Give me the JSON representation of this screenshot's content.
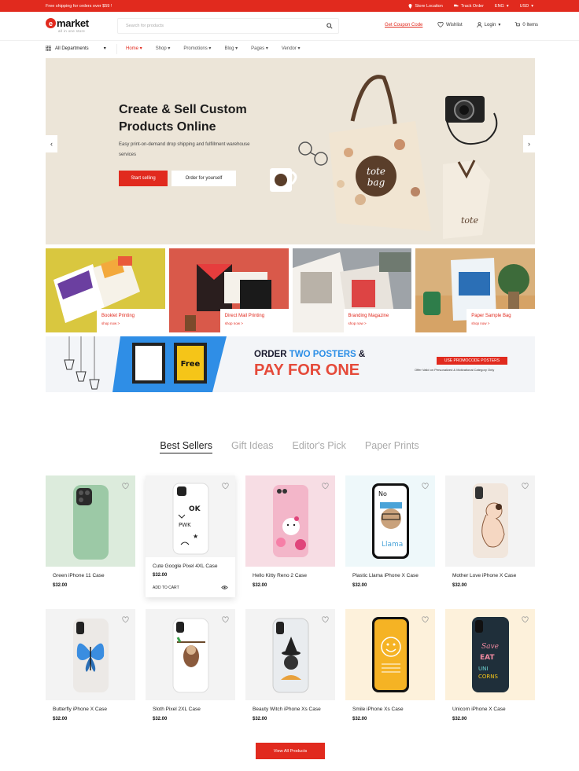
{
  "topbar": {
    "promo": "Free shipping for orders over $59 !",
    "store_location": "Store Location",
    "track_order": "Track Order",
    "language": "ENG",
    "currency": "USD"
  },
  "header": {
    "logo_letter": "e",
    "logo_word": "market",
    "logo_tagline": "all in one store",
    "search_placeholder": "Search for products",
    "coupon": "Get Coupon Code",
    "wishlist": "Wishlist",
    "login": "Login",
    "cart": "0 Items"
  },
  "nav": {
    "departments": "All Departments",
    "items": [
      "Home",
      "Shop",
      "Promotions",
      "Blog",
      "Pages",
      "Vendor"
    ]
  },
  "hero": {
    "title": "Create & Sell Custom Products Online",
    "subtitle": "Easy print-on-demand drop shipping and fulfillment warehouse services",
    "primary_button": "Start selling",
    "secondary_button": "Order for yourself",
    "prev": "‹",
    "next": "›"
  },
  "categories": [
    {
      "name": "Booklet Printing",
      "link": "shop now >"
    },
    {
      "name": "Direct Mail Printing",
      "link": "shop now >"
    },
    {
      "name": "Branding Magazine",
      "link": "shop now >"
    },
    {
      "name": "Paper Sample Bag",
      "link": "shop now >"
    }
  ],
  "banner": {
    "order_1": "ORDER ",
    "order_2": "TWO POSTERS",
    "order_3": " &",
    "pay": "PAY FOR ONE",
    "promo": "USE PROMOCODE POSTERS",
    "offer": "Offer Valid on Personalized & Motivational Category Only"
  },
  "tabs": [
    "Best Sellers",
    "Gift Ideas",
    "Editor's Pick",
    "Paper Prints"
  ],
  "products": [
    {
      "name": "Green iPhone 11 Case",
      "price": "$32.00"
    },
    {
      "name": "Cute Google Pixel 4XL Case",
      "price": "$32.00",
      "action": "ADD TO CART"
    },
    {
      "name": "Hello Kitty Reno 2 Case",
      "price": "$32.00"
    },
    {
      "name": "Plastic Llama iPhone X Case",
      "price": "$32.00"
    },
    {
      "name": "Mother Love iPhone X Case",
      "price": "$32.00"
    },
    {
      "name": "Butterfly iPhone X Case",
      "price": "$32.00"
    },
    {
      "name": "Sloth Pixel 2XL Case",
      "price": "$32.00"
    },
    {
      "name": "Beauty Witch iPhone Xs Case",
      "price": "$32.00"
    },
    {
      "name": "Smile iPhone Xs Case",
      "price": "$32.00"
    },
    {
      "name": "Unicorn iPhone X Case",
      "price": "$32.00"
    }
  ],
  "view_all": "View All Products",
  "colors": {
    "accent": "#e12a1e",
    "hero_bg": "#ece5d8"
  }
}
